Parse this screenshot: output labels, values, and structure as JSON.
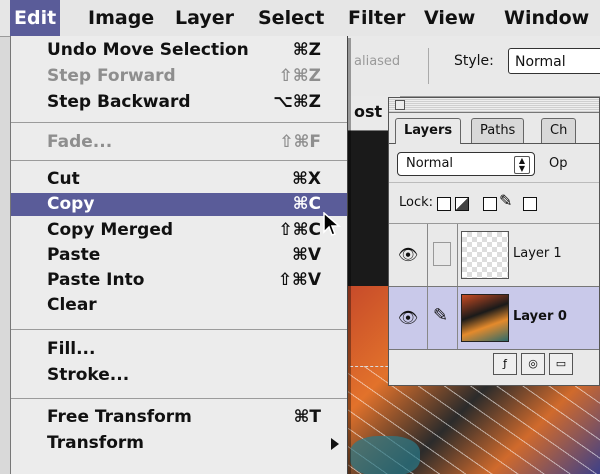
{
  "menubar": {
    "items": [
      "Edit",
      "Image",
      "Layer",
      "Select",
      "Filter",
      "View",
      "Window"
    ],
    "active_index": 0
  },
  "options_bar": {
    "aliased_text": "aliased",
    "style_label": "Style:",
    "style_value": "Normal"
  },
  "document": {
    "title_fragment": "ost"
  },
  "edit_menu": {
    "items": [
      {
        "label": "Undo Move Selection",
        "shortcut": "⌘Z",
        "enabled": true
      },
      {
        "label": "Step Forward",
        "shortcut": "⇧⌘Z",
        "enabled": false
      },
      {
        "label": "Step Backward",
        "shortcut": "⌥⌘Z",
        "enabled": true
      },
      {
        "label": "Fade...",
        "shortcut": "⇧⌘F",
        "enabled": false
      },
      {
        "label": "Cut",
        "shortcut": "⌘X",
        "enabled": true
      },
      {
        "label": "Copy",
        "shortcut": "⌘C",
        "enabled": true,
        "highlighted": true
      },
      {
        "label": "Copy Merged",
        "shortcut": "⇧⌘C",
        "enabled": true
      },
      {
        "label": "Paste",
        "shortcut": "⌘V",
        "enabled": true
      },
      {
        "label": "Paste Into",
        "shortcut": "⇧⌘V",
        "enabled": true
      },
      {
        "label": "Clear",
        "shortcut": "",
        "enabled": true
      },
      {
        "label": "Fill...",
        "shortcut": "",
        "enabled": true
      },
      {
        "label": "Stroke...",
        "shortcut": "",
        "enabled": true
      },
      {
        "label": "Free Transform",
        "shortcut": "⌘T",
        "enabled": true
      },
      {
        "label": "Transform",
        "shortcut": "",
        "enabled": true,
        "submenu": true
      }
    ]
  },
  "layers_palette": {
    "tabs": [
      "Layers",
      "Paths",
      "Ch"
    ],
    "active_tab": "Layers",
    "blend_mode": "Normal",
    "opacity_label": "Op",
    "lock_label": "Lock:",
    "layers": [
      {
        "name": "Layer 1",
        "visible": true,
        "selected": false
      },
      {
        "name": "Layer 0",
        "visible": true,
        "selected": true
      }
    ]
  },
  "colors": {
    "menu_highlight": "#5a5c99",
    "layer_selected": "#c9c9ea",
    "disabled_text": "#8e8e8e"
  },
  "icons": [
    "eye-icon",
    "paintbrush-icon",
    "submenu-arrow-icon",
    "mouse-pointer-icon"
  ]
}
